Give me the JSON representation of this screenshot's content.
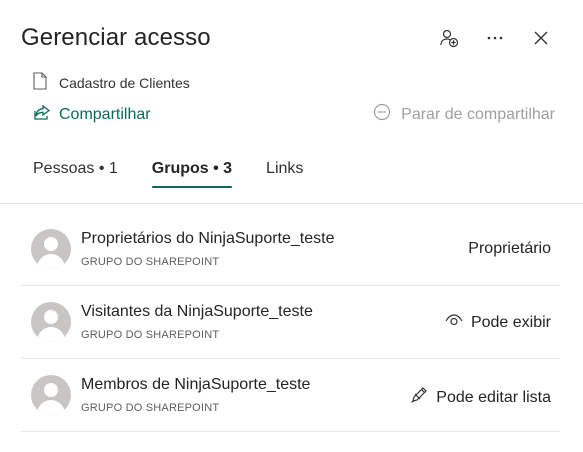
{
  "header": {
    "title": "Gerenciar acesso",
    "icons": [
      "add-person-icon",
      "more-icon",
      "close-icon"
    ]
  },
  "file": {
    "name": "Cadastro de Clientes",
    "icon": "document-icon"
  },
  "actions": {
    "share_label": "Compartilhar",
    "stop_share_label": "Parar de compartilhar"
  },
  "tabs": [
    {
      "label": "Pessoas • 1",
      "active": false
    },
    {
      "label": "Grupos • 3",
      "active": true
    },
    {
      "label": "Links",
      "active": false
    }
  ],
  "groups": [
    {
      "name": "Proprietários do NinjaSuporte_teste",
      "type": "GRUPO DO SHAREPOINT",
      "permission": "Proprietário",
      "permission_icon": ""
    },
    {
      "name": "Visitantes da NinjaSuporte_teste",
      "type": "GRUPO DO SHAREPOINT",
      "permission": "Pode exibir",
      "permission_icon": "eye-icon"
    },
    {
      "name": "Membros de NinjaSuporte_teste",
      "type": "GRUPO DO SHAREPOINT",
      "permission": "Pode editar lista",
      "permission_icon": "pencil-icon"
    }
  ],
  "colors": {
    "accent": "#0b6a5e",
    "disabled": "#a19f9d",
    "avatar": "#c8c6c4"
  }
}
